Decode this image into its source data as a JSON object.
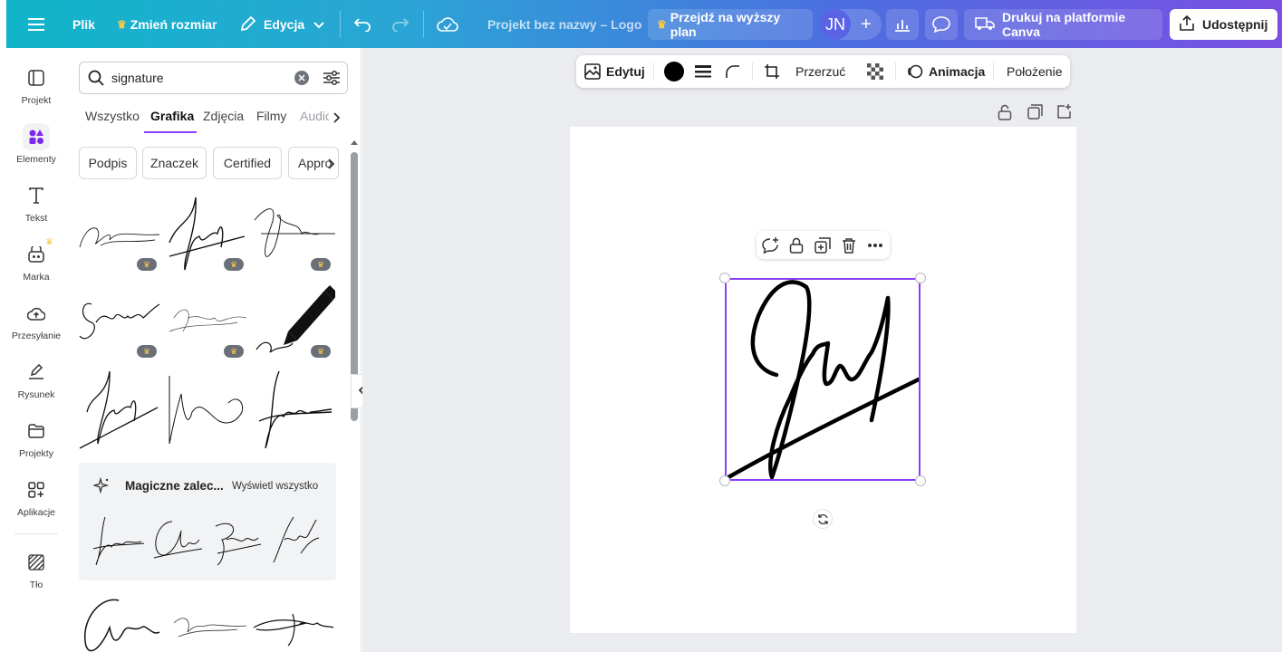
{
  "topbar": {
    "menu_icon": "hamburger-icon",
    "file": "Plik",
    "resize": "Zmień rozmiar",
    "edit": "Edycja",
    "title": "Projekt bez nazwy – Logo",
    "upgrade": "Przejdź na wyższy plan",
    "avatar": "JN",
    "print": "Drukuj na platformie Canva",
    "share": "Udostępnij"
  },
  "rail": {
    "items": [
      {
        "label": "Projekt",
        "icon": "layout-icon"
      },
      {
        "label": "Elementy",
        "icon": "elements-icon"
      },
      {
        "label": "Tekst",
        "icon": "text-icon"
      },
      {
        "label": "Marka",
        "icon": "brand-icon"
      },
      {
        "label": "Przesyłanie",
        "icon": "upload-icon"
      },
      {
        "label": "Rysunek",
        "icon": "draw-icon"
      },
      {
        "label": "Projekty",
        "icon": "folder-icon"
      },
      {
        "label": "Aplikacje",
        "icon": "apps-icon"
      },
      {
        "label": "Tło",
        "icon": "background-icon"
      }
    ]
  },
  "panel": {
    "search_value": "signature",
    "tabs": [
      "Wszystko",
      "Grafika",
      "Zdjęcia",
      "Filmy",
      "Audio"
    ],
    "chips": [
      "Podpis",
      "Znaczek",
      "Certified",
      "Appro"
    ],
    "magic_title": "Magiczne zalec...",
    "magic_view_all": "Wyświetl wszystko"
  },
  "context": {
    "edit": "Edytuj",
    "crop": "Przerzuć",
    "animate": "Animacja",
    "position": "Położenie",
    "color": "#000000"
  },
  "colors": {
    "accent": "#8b3dff",
    "crown": "#f7c948"
  }
}
